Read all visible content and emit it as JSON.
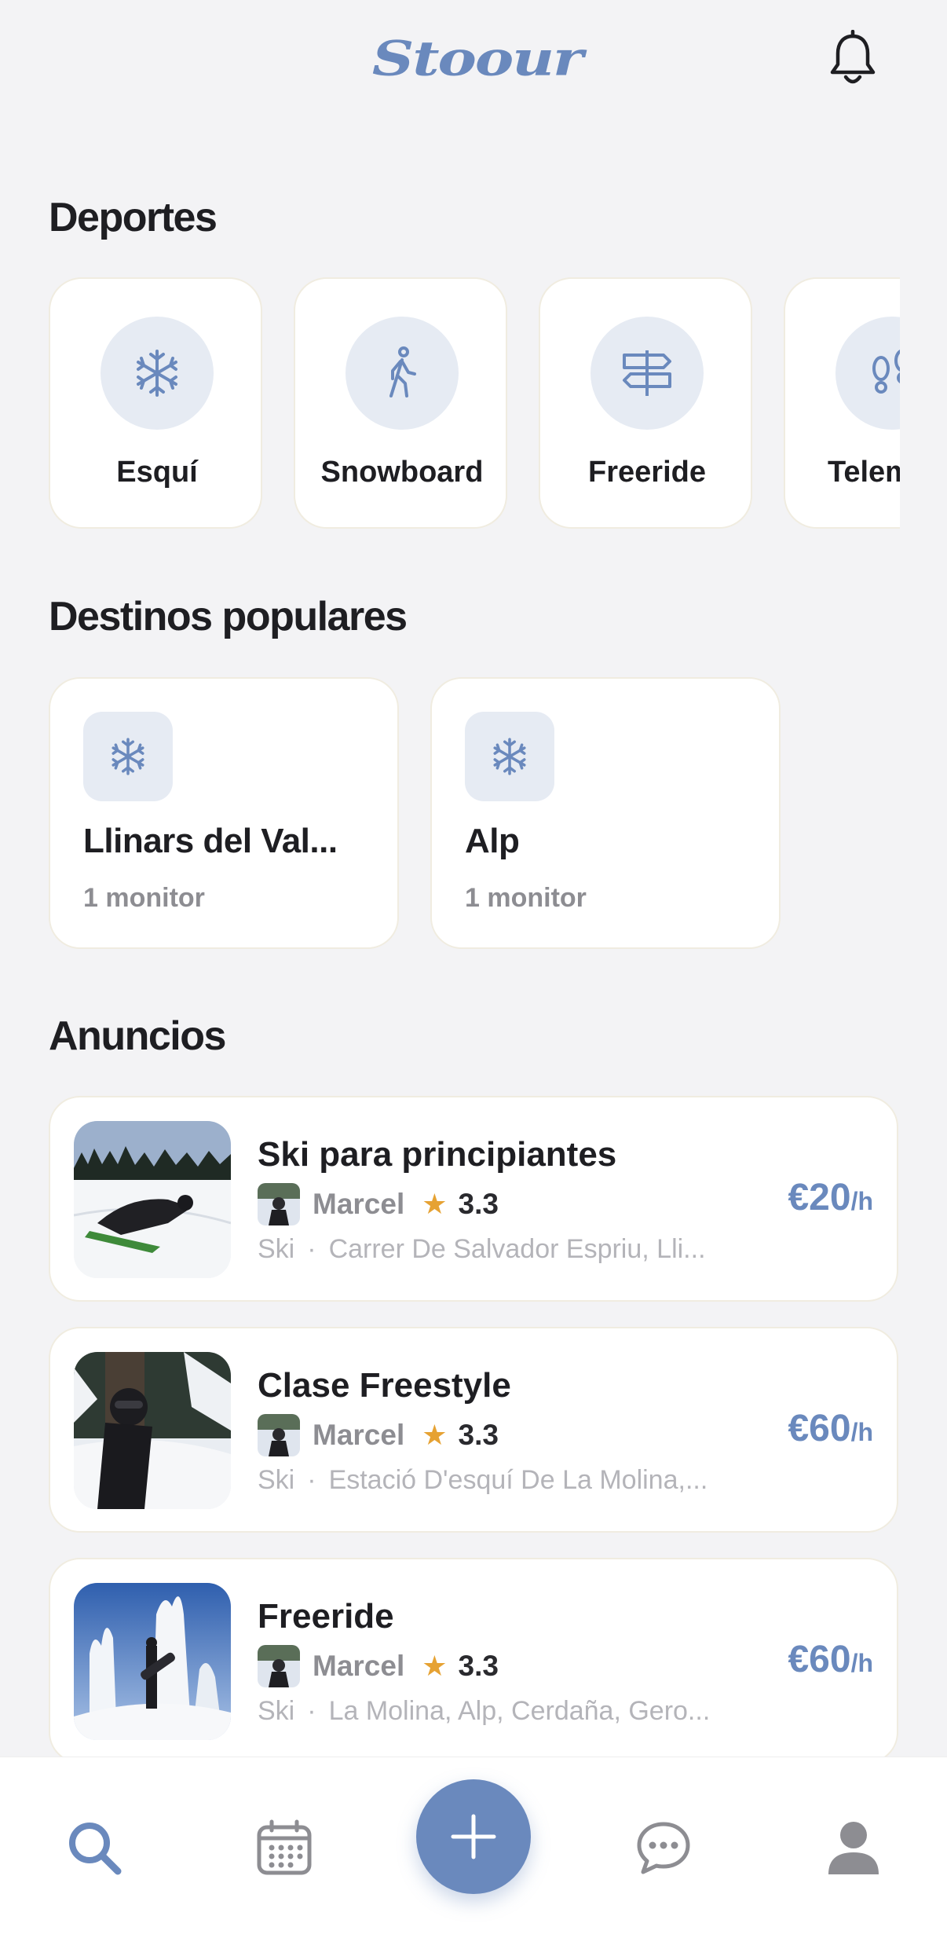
{
  "header": {
    "logo_text": "Stoour",
    "notifications_icon": "bell-icon"
  },
  "sports": {
    "title": "Deportes",
    "items": [
      {
        "label": "Esquí",
        "icon": "snowflake-icon"
      },
      {
        "label": "Snowboard",
        "icon": "walking-person-icon"
      },
      {
        "label": "Freeride",
        "icon": "signpost-icon"
      },
      {
        "label": "Telemark",
        "icon": "footprints-icon"
      }
    ]
  },
  "destinations": {
    "title": "Destinos populares",
    "items": [
      {
        "name": "Llinars del Val...",
        "count": "1 monitor",
        "icon": "snowflake-icon"
      },
      {
        "name": "Alp",
        "count": "1 monitor",
        "icon": "snowflake-icon"
      }
    ]
  },
  "ads": {
    "title": "Anuncios",
    "items": [
      {
        "title": "Ski para principiantes",
        "user": "Marcel",
        "star": "★",
        "rating": "3.3",
        "sport": "Ski",
        "separator": "·",
        "location": "Carrer De Salvador Espriu, Lli...",
        "price": "€20",
        "unit": "/h"
      },
      {
        "title": "Clase Freestyle",
        "user": "Marcel",
        "star": "★",
        "rating": "3.3",
        "sport": "Ski",
        "separator": "·",
        "location": "Estació D'esquí De La Molina,...",
        "price": "€60",
        "unit": "/h"
      },
      {
        "title": "Freeride",
        "user": "Marcel",
        "star": "★",
        "rating": "3.3",
        "sport": "Ski",
        "separator": "·",
        "location": "La Molina, Alp, Cerdaña, Gero...",
        "price": "€60",
        "unit": "/h"
      }
    ]
  },
  "tabbar": {
    "tabs": [
      {
        "icon": "search-icon",
        "active": true
      },
      {
        "icon": "calendar-icon",
        "active": false
      },
      {
        "icon": "plus-icon",
        "active": false
      },
      {
        "icon": "chat-icon",
        "active": false
      },
      {
        "icon": "user-icon",
        "active": false
      }
    ]
  },
  "colors": {
    "accent": "#6a89bd",
    "background": "#f3f3f5",
    "card": "#ffffff",
    "icon_bg": "#e6ebf3",
    "star": "#e6a233",
    "muted_text": "#8d8d92"
  }
}
